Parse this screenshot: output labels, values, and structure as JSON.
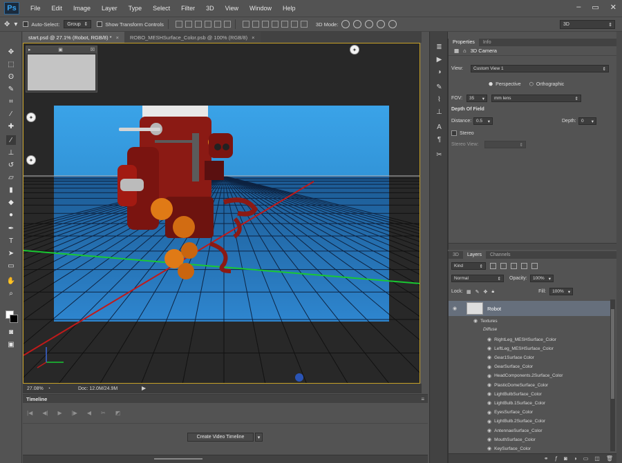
{
  "menu": {
    "logo": "Ps",
    "items": [
      "File",
      "Edit",
      "Image",
      "Layer",
      "Type",
      "Select",
      "Filter",
      "3D",
      "View",
      "Window",
      "Help"
    ]
  },
  "options": {
    "auto_select": "Auto-Select:",
    "group": "Group",
    "show_transform": "Show Transform Controls",
    "mode_3d": "3D Mode:",
    "workspace": "3D"
  },
  "tabs": [
    {
      "label": "start.psd @ 27.1% (Robot, RGB/8) *",
      "active": true
    },
    {
      "label": "ROBO_MESHSurface_Color.psb @ 100% (RGB/8)",
      "active": false
    }
  ],
  "status": {
    "zoom": "27.08%",
    "doc": "Doc: 12.0M/24.9M"
  },
  "timeline": {
    "title": "Timeline",
    "create_button": "Create Video Timeline"
  },
  "properties": {
    "tabs": [
      "Properties",
      "Info"
    ],
    "title": "3D Camera",
    "view_label": "View:",
    "view_value": "Custom View 1",
    "perspective": "Perspective",
    "orthographic": "Orthographic",
    "fov_label": "FOV:",
    "fov_value": "35",
    "fov_unit": "mm lens",
    "dof_title": "Depth Of Field",
    "distance_label": "Distance:",
    "distance_value": "0.5",
    "depth_label": "Depth:",
    "depth_value": "0",
    "stereo": "Stereo",
    "stereo_view": "Stereo View:"
  },
  "layers": {
    "tabs": [
      "3D",
      "Layers",
      "Channels"
    ],
    "kind": "Kind",
    "blend": "Normal",
    "opacity_label": "Opacity:",
    "opacity_value": "100%",
    "lock_label": "Lock:",
    "fill_label": "Fill:",
    "fill_value": "100%",
    "layer_name": "Robot",
    "textures": "Textures",
    "diffuse": "Diffuse",
    "items": [
      "RightLeg_MESHSurface_Color",
      "LeftLeg_MESHSurface_Color",
      "Gear1Surface Color",
      "GearSurface_Color",
      "HeadComponents.2Surface_Color",
      "PlasticDomeSurface_Color",
      "LightBulbSurface_Color",
      "LightBulb.1Surface_Color",
      "EyesSurface_Color",
      "LightBulb.2Surface_Color",
      "AntennaeSurface_Color",
      "MouthSurface_Color",
      "KeySurface_Color"
    ]
  },
  "colors": {
    "accent_gold": "#c9a227",
    "selected_layer": "#666f7c",
    "sky_top": "#3aa3e8",
    "sky_bottom": "#2277b9",
    "grid_line": "#0d2240",
    "x_axis": "#c01a1a",
    "z_axis": "#19c932"
  }
}
